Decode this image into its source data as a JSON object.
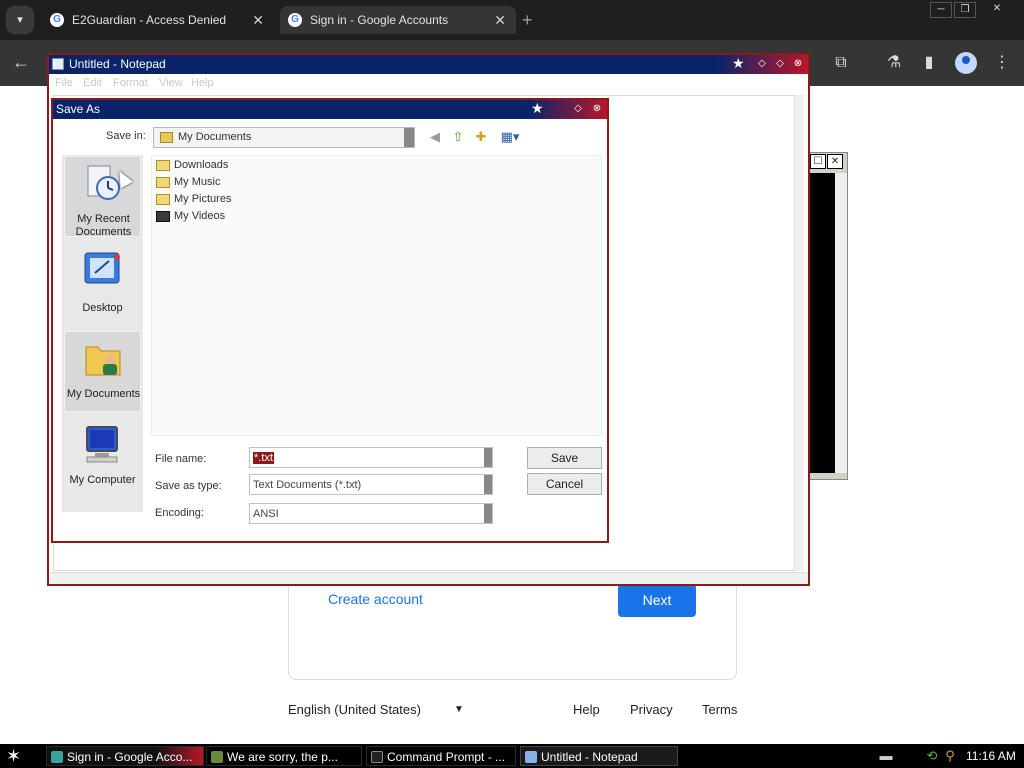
{
  "browser": {
    "tabs": [
      {
        "title": "E2Guardian - Access Denied",
        "close": "✕"
      },
      {
        "title": "Sign in - Google Accounts",
        "close": "✕"
      }
    ],
    "new_tab": "+",
    "tab_search_icon": "chevron-down-icon",
    "window_controls": [
      "─",
      "❐",
      "✕"
    ]
  },
  "google": {
    "create_account": "Create account",
    "next": "Next",
    "language": "English (United States)",
    "footer_links": [
      "Help",
      "Privacy",
      "Terms"
    ]
  },
  "notepad": {
    "title": "Untitled - Notepad",
    "menu": [
      "File",
      "Edit",
      "Format",
      "View",
      "Help"
    ]
  },
  "save_as": {
    "title": "Save As",
    "save_in_label": "Save in:",
    "save_in_value": "My Documents",
    "places": [
      "My Recent Documents",
      "Desktop",
      "My Documents",
      "My Computer"
    ],
    "files": [
      "Downloads",
      "My Music",
      "My Pictures",
      "My Videos"
    ],
    "file_name_label": "File name:",
    "file_name_value": "*.txt",
    "save_as_type_label": "Save as type:",
    "save_as_type_value": "Text Documents (*.txt)",
    "encoding_label": "Encoding:",
    "encoding_value": "ANSI",
    "save_button": "Save",
    "cancel_button": "Cancel"
  },
  "taskbar": {
    "tasks": [
      "Sign in - Google Acco...",
      "We are sorry, the p...",
      "Command Prompt - ...",
      "Untitled - Notepad"
    ],
    "clock": "11:16 AM"
  },
  "colors": {
    "title_bar": "#0a246a",
    "accent_red": "#8b1a1a",
    "google_blue": "#1a73e8"
  }
}
